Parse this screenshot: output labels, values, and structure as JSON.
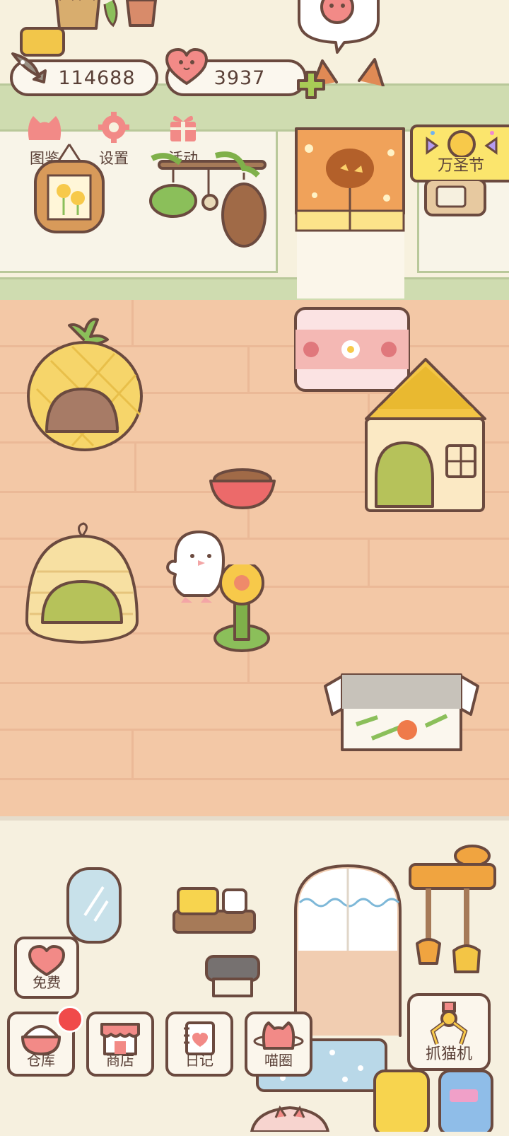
{
  "currency": {
    "fish_amount": "114688",
    "heart_amount": "3937"
  },
  "top_menu": {
    "album_label": "图鉴",
    "settings_label": "设置",
    "events_label": "活动"
  },
  "event_banner": {
    "label": "万圣节"
  },
  "bottom_menu": {
    "free_label": "免费",
    "warehouse_label": "仓库",
    "shop_label": "商店",
    "diary_label": "日记",
    "social_label": "喵圈",
    "claw_label": "抓猫机"
  },
  "colors": {
    "outline": "#6b4a3f",
    "floor": "#f3c8a6",
    "accent_pink": "#f28a87",
    "notification": "#f04a4a",
    "banner_yellow": "#fbe56d"
  },
  "icons": {
    "fish": "fish-icon",
    "heart": "heart-icon",
    "plus": "plus-icon",
    "album": "cat-head-icon",
    "settings": "gear-icon",
    "events": "gift-icon",
    "candy": "candy-icon",
    "warehouse": "rice-bowl-icon",
    "shop": "store-icon",
    "diary": "notebook-icon",
    "social": "cat-planet-icon",
    "claw": "claw-icon"
  }
}
